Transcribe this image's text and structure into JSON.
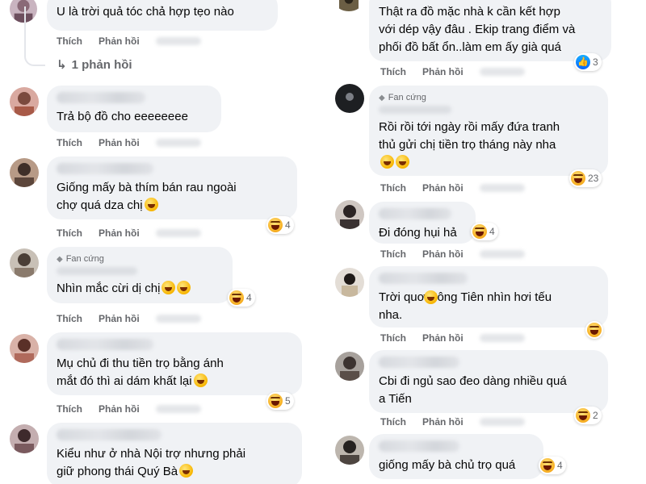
{
  "actions": {
    "like": "Thích",
    "reply": "Phản hồi"
  },
  "fan_badge": "Fan cứng",
  "left": [
    {
      "text": "U là trời quả tóc chả hợp tẹo nào",
      "reaction_count": ""
    },
    {
      "text": "Trả bộ đồ cho eeeeeeee",
      "reaction_count": ""
    },
    {
      "text": "Giống mấy bà thím bán rau ngoài\nchợ quá dza chị",
      "reaction_count": "4"
    },
    {
      "text": "Nhìn mắc cừi dị chị",
      "reaction_count": "4"
    },
    {
      "text": "Mụ chủ đi thu tiền trọ bằng ánh\nmắt đó thì ai dám khất lại",
      "reaction_count": "5"
    },
    {
      "text": "Kiểu như ở nhà Nội trợ nhưng phải\ngiữ phong thái Quý Bà",
      "reaction_count": ""
    }
  ],
  "reply_link": "1 phản hồi",
  "right": [
    {
      "text": "Thật ra đồ mặc nhà k cần kết hợp\nvới dép vậy đâu . Ekip trang điểm và\nphối đồ bất ổn..làm em ấy già quá",
      "reaction_count": "3"
    },
    {
      "text": "Rồi rồi tới ngày rồi mấy đứa tranh\nthủ gửi chị tiền trọ tháng này nha",
      "reaction_count": "23"
    },
    {
      "text": "Đi đóng hụi hả",
      "reaction_count": "4"
    },
    {
      "text": "Trời quơ  Nông Tiên nhìn hơi tếu\nnha.",
      "reaction_count": ""
    },
    {
      "text": "Cbi đi ngủ sao đeo dàng nhiều quá\na Tiến",
      "reaction_count": "2"
    },
    {
      "text": "giống mấy bà chủ trọ quá",
      "reaction_count": "4"
    }
  ]
}
